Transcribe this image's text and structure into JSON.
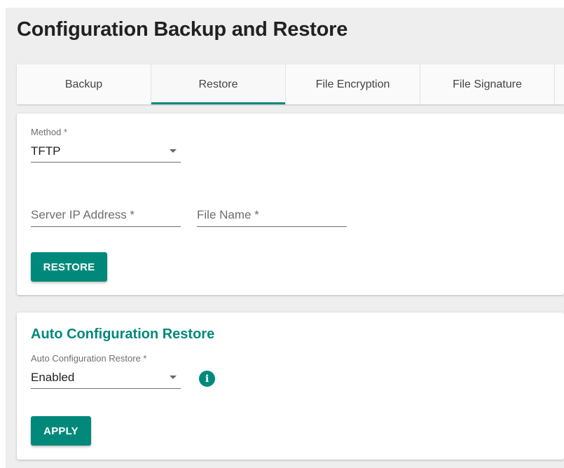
{
  "page": {
    "title": "Configuration Backup and Restore"
  },
  "tabs": [
    {
      "label": "Backup",
      "active": false
    },
    {
      "label": "Restore",
      "active": true
    },
    {
      "label": "File Encryption",
      "active": false
    },
    {
      "label": "File Signature",
      "active": false
    }
  ],
  "restore": {
    "method_label": "Method *",
    "method_value": "TFTP",
    "server_ip_placeholder": "Server IP Address *",
    "file_name_placeholder": "File Name *",
    "restore_button": "RESTORE"
  },
  "auto_restore": {
    "section_title": "Auto Configuration Restore",
    "field_label": "Auto Configuration Restore *",
    "field_value": "Enabled",
    "info_icon_glyph": "i",
    "apply_button": "APPLY"
  },
  "colors": {
    "accent": "#00897b",
    "page_background": "#eeeeee",
    "card_background": "#ffffff"
  },
  "icons": {
    "dropdown": "chevron-down-icon",
    "info": "info-icon"
  }
}
